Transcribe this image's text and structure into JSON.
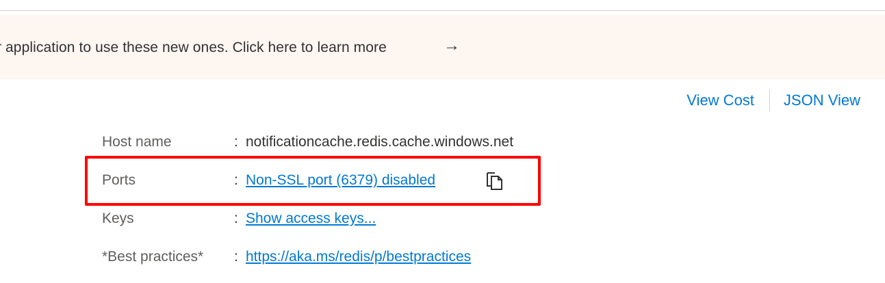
{
  "banner": {
    "text": "r application to use these new ones. Click here to learn more",
    "arrow_icon": "arrow-right-icon"
  },
  "toolbar": {
    "view_cost_label": "View Cost",
    "json_view_label": "JSON View"
  },
  "properties": [
    {
      "label": "Host name",
      "value": "notificationcache.redis.cache.windows.net",
      "is_link": false
    },
    {
      "label": "Ports",
      "value": "Non-SSL port (6379) disabled",
      "is_link": true,
      "icon": "copy-icon"
    },
    {
      "label": "Keys",
      "value": "Show access keys...",
      "is_link": true
    },
    {
      "label": "*Best practices*",
      "value": "https://aka.ms/redis/p/bestpractices",
      "is_link": true
    }
  ],
  "separator": ":",
  "colors": {
    "link": "#0078d4",
    "banner_background": "#fdf6f1",
    "highlight": "#ff0000",
    "label": "#605e5c",
    "text": "#323130"
  }
}
